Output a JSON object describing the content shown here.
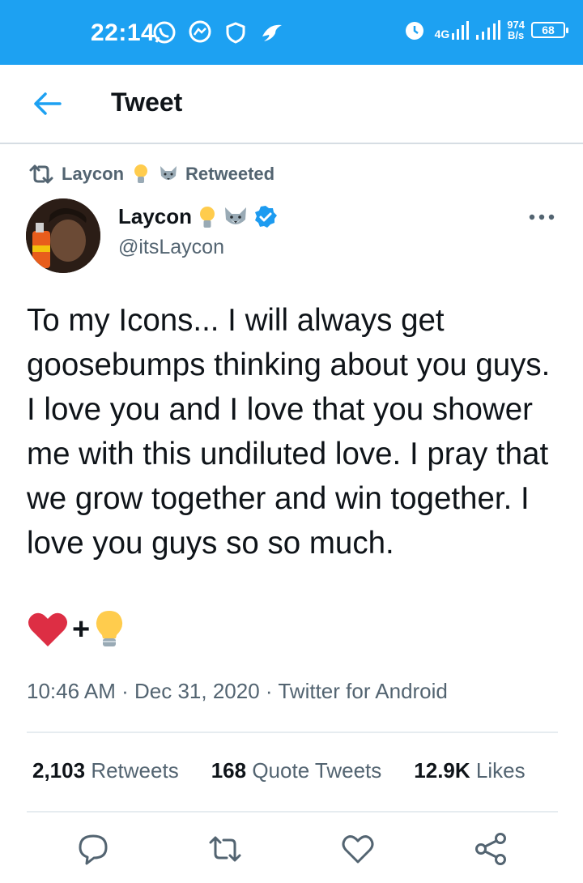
{
  "status_bar": {
    "time": "22:14",
    "network": "4G",
    "speed_value": "974",
    "speed_unit": "B/s",
    "battery": "68",
    "icons_left": [
      "whatsapp-icon",
      "messenger-icon",
      "shield-icon",
      "bird-icon"
    ],
    "icons_right": [
      "alarm-icon",
      "signal-icon",
      "signal-icon",
      "battery-icon"
    ]
  },
  "header": {
    "title": "Tweet",
    "back_icon": "arrow-left-icon"
  },
  "retweet": {
    "by": "Laycon",
    "label": "Retweeted",
    "icon": "retweet-icon"
  },
  "author": {
    "name": "Laycon",
    "handle": "@itsLaycon",
    "verified": true,
    "emojis": [
      "lightbulb-icon",
      "wolf-icon"
    ]
  },
  "tweet": {
    "text": "To my Icons... I will always get goosebumps thinking about you guys. I love you and I love that you shower me with this undiluted love. I pray that we grow together and win together. I love you guys so so much.",
    "emoji_plus": "+",
    "emoji_line": [
      "heart-icon",
      "lightbulb-icon"
    ]
  },
  "meta": {
    "time": "10:46 AM",
    "separator": "·",
    "date": "Dec 31, 2020",
    "source": "Twitter for Android"
  },
  "stats": {
    "retweets_count": "2,103",
    "retweets_label": "Retweets",
    "quotes_count": "168",
    "quotes_label": "Quote Tweets",
    "likes_count": "12.9K",
    "likes_label": "Likes"
  },
  "actions": [
    "reply-icon",
    "retweet-icon",
    "like-icon",
    "share-icon"
  ],
  "colors": {
    "brand": "#1da1f2",
    "text": "#0f1419",
    "secondary": "#536471",
    "verified": "#1d9bf0",
    "heart": "#e0245e"
  }
}
